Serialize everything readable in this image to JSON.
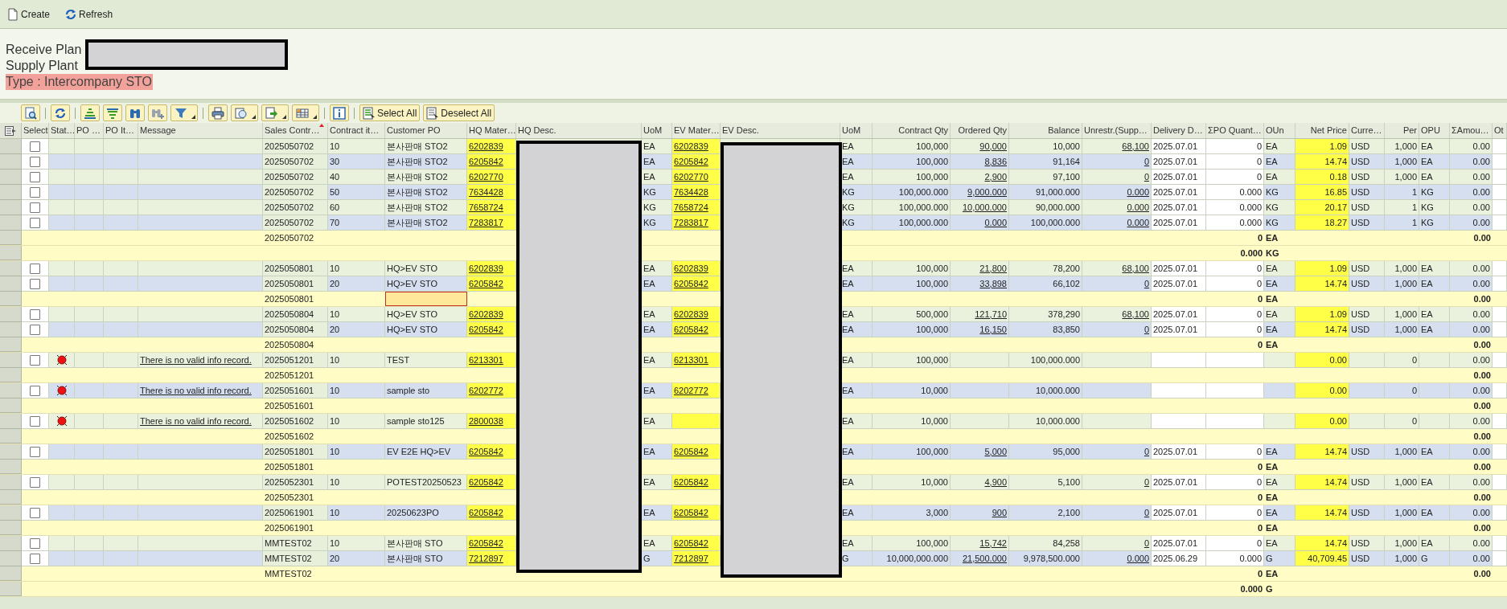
{
  "toolbar": [
    {
      "kind": "create",
      "label": "Create"
    },
    {
      "kind": "refresh",
      "label": "Refresh"
    }
  ],
  "header": {
    "receive_plant": "Receive Plan",
    "supply_plant": "Supply Plant",
    "type": "Type : Intercompany STO"
  },
  "grid_toolbar": {
    "select_all": "Select All",
    "deselect_all": "Deselect All"
  },
  "columns": [
    {
      "label": "Select",
      "sorted": false
    },
    {
      "label": "Stat…",
      "sorted": false
    },
    {
      "label": "PO …",
      "sorted": false
    },
    {
      "label": "PO It…",
      "sorted": false
    },
    {
      "label": "Message",
      "sorted": false
    },
    {
      "label": "Sales Contr…",
      "sorted": true
    },
    {
      "label": "Contract it…",
      "sorted": false
    },
    {
      "label": "Customer PO",
      "sorted": false
    },
    {
      "label": "HQ Mater…",
      "sorted": false
    },
    {
      "label": "HQ Desc.",
      "sorted": false
    },
    {
      "label": "UoM",
      "sorted": false
    },
    {
      "label": "EV Mater…",
      "sorted": false
    },
    {
      "label": "EV Desc.",
      "sorted": false
    },
    {
      "label": "UoM",
      "sorted": false
    },
    {
      "label": "Contract Qty",
      "sorted": false
    },
    {
      "label": "Ordered Qty",
      "sorted": false
    },
    {
      "label": "Balance",
      "sorted": false
    },
    {
      "label": "Unrestr.(Supp…",
      "sorted": false
    },
    {
      "label": "Delivery D…",
      "sorted": false
    },
    {
      "label": "ΣPO Quant…",
      "sorted": false
    },
    {
      "label": "OUn",
      "sorted": false
    },
    {
      "label": "Net Price",
      "sorted": false
    },
    {
      "label": "Curre…",
      "sorted": false
    },
    {
      "label": "Per",
      "sorted": false
    },
    {
      "label": "OPU",
      "sorted": false
    },
    {
      "label": "ΣAmou…",
      "sorted": false
    },
    {
      "label": "Ot",
      "sorted": false
    }
  ],
  "rows": [
    {
      "kind": "item",
      "checked": false,
      "error": false,
      "sales_contract": "2025050702",
      "contract_item": "10",
      "customer_po": "본사판매 STO2",
      "hq_material": "6202839",
      "hq_uom": "EA",
      "ev_material": "6202839",
      "ev_uom": "EA",
      "contract_qty": "100,000",
      "ordered_qty": "90,000",
      "balance": "10,000",
      "unrestricted": "68,100",
      "delivery_date": "2025.07.01",
      "po_quantity": "0",
      "oun": "EA",
      "net_price": "1.09",
      "currency": "USD",
      "per": "1,000",
      "opu": "EA",
      "amount": "0.00"
    },
    {
      "kind": "item",
      "checked": false,
      "error": false,
      "sales_contract": "2025050702",
      "contract_item": "30",
      "customer_po": "본사판매 STO2",
      "hq_material": "6205842",
      "hq_uom": "EA",
      "ev_material": "6205842",
      "ev_uom": "EA",
      "contract_qty": "100,000",
      "ordered_qty": "8,836",
      "balance": "91,164",
      "unrestricted": "0",
      "delivery_date": "2025.07.01",
      "po_quantity": "0",
      "oun": "EA",
      "net_price": "14.74",
      "currency": "USD",
      "per": "1,000",
      "opu": "EA",
      "amount": "0.00"
    },
    {
      "kind": "item",
      "checked": false,
      "error": false,
      "sales_contract": "2025050702",
      "contract_item": "40",
      "customer_po": "본사판매 STO2",
      "hq_material": "6202770",
      "hq_uom": "EA",
      "ev_material": "6202770",
      "ev_uom": "EA",
      "contract_qty": "100,000",
      "ordered_qty": "2,900",
      "balance": "97,100",
      "unrestricted": "0",
      "delivery_date": "2025.07.01",
      "po_quantity": "0",
      "oun": "EA",
      "net_price": "0.18",
      "currency": "USD",
      "per": "1,000",
      "opu": "EA",
      "amount": "0.00"
    },
    {
      "kind": "item",
      "checked": false,
      "error": false,
      "sales_contract": "2025050702",
      "contract_item": "50",
      "customer_po": "본사판매 STO2",
      "hq_material": "7634428",
      "hq_uom": "KG",
      "ev_material": "7634428",
      "ev_uom": "KG",
      "contract_qty": "100,000.000",
      "ordered_qty": "9,000.000",
      "balance": "91,000.000",
      "unrestricted": "0.000",
      "delivery_date": "2025.07.01",
      "po_quantity": "0.000",
      "oun": "KG",
      "net_price": "16.85",
      "currency": "USD",
      "per": "1",
      "opu": "KG",
      "amount": "0.00"
    },
    {
      "kind": "item",
      "checked": false,
      "error": false,
      "sales_contract": "2025050702",
      "contract_item": "60",
      "customer_po": "본사판매 STO2",
      "hq_material": "7658724",
      "hq_uom": "KG",
      "ev_material": "7658724",
      "ev_uom": "KG",
      "contract_qty": "100,000.000",
      "ordered_qty": "10,000.000",
      "balance": "90,000.000",
      "unrestricted": "0.000",
      "delivery_date": "2025.07.01",
      "po_quantity": "0.000",
      "oun": "KG",
      "net_price": "20.17",
      "currency": "USD",
      "per": "1",
      "opu": "KG",
      "amount": "0.00"
    },
    {
      "kind": "item",
      "checked": false,
      "error": false,
      "sales_contract": "2025050702",
      "contract_item": "70",
      "customer_po": "본사판매 STO2",
      "hq_material": "7283817",
      "hq_uom": "KG",
      "ev_material": "7283817",
      "ev_uom": "KG",
      "contract_qty": "100,000.000",
      "ordered_qty": "0.000",
      "balance": "100,000.000",
      "unrestricted": "0.000",
      "delivery_date": "2025.07.01",
      "po_quantity": "0.000",
      "oun": "KG",
      "net_price": "18.27",
      "currency": "USD",
      "per": "1",
      "opu": "KG",
      "amount": "0.00"
    },
    {
      "kind": "subtotal",
      "focused": false,
      "sales_contract": "2025050702",
      "po_quantity": "0",
      "oun": "EA",
      "amount": "0.00"
    },
    {
      "kind": "subtotal",
      "focused": false,
      "po_quantity": "0.000",
      "oun": "KG"
    },
    {
      "kind": "item",
      "checked": false,
      "error": false,
      "sales_contract": "2025050801",
      "contract_item": "10",
      "customer_po": "HQ>EV STO",
      "hq_material": "6202839",
      "hq_uom": "EA",
      "ev_material": "6202839",
      "ev_uom": "EA",
      "contract_qty": "100,000",
      "ordered_qty": "21,800",
      "balance": "78,200",
      "unrestricted": "68,100",
      "delivery_date": "2025.07.01",
      "po_quantity": "0",
      "oun": "EA",
      "net_price": "1.09",
      "currency": "USD",
      "per": "1,000",
      "opu": "EA",
      "amount": "0.00"
    },
    {
      "kind": "item",
      "checked": false,
      "error": false,
      "sales_contract": "2025050801",
      "contract_item": "20",
      "customer_po": "HQ>EV STO",
      "hq_material": "6205842",
      "hq_uom": "EA",
      "ev_material": "6205842",
      "ev_uom": "EA",
      "contract_qty": "100,000",
      "ordered_qty": "33,898",
      "balance": "66,102",
      "unrestricted": "0",
      "delivery_date": "2025.07.01",
      "po_quantity": "0",
      "oun": "EA",
      "net_price": "14.74",
      "currency": "USD",
      "per": "1,000",
      "opu": "EA",
      "amount": "0.00"
    },
    {
      "kind": "subtotal",
      "focused": true,
      "sales_contract": "2025050801",
      "po_quantity": "0",
      "oun": "EA",
      "amount": "0.00"
    },
    {
      "kind": "item",
      "checked": false,
      "error": false,
      "sales_contract": "2025050804",
      "contract_item": "10",
      "customer_po": "HQ>EV STO",
      "hq_material": "6202839",
      "hq_uom": "EA",
      "ev_material": "6202839",
      "ev_uom": "EA",
      "contract_qty": "500,000",
      "ordered_qty": "121,710",
      "balance": "378,290",
      "unrestricted": "68,100",
      "delivery_date": "2025.07.01",
      "po_quantity": "0",
      "oun": "EA",
      "net_price": "1.09",
      "currency": "USD",
      "per": "1,000",
      "opu": "EA",
      "amount": "0.00"
    },
    {
      "kind": "item",
      "checked": false,
      "error": false,
      "sales_contract": "2025050804",
      "contract_item": "20",
      "customer_po": "HQ>EV STO",
      "hq_material": "6205842",
      "hq_uom": "EA",
      "ev_material": "6205842",
      "ev_uom": "EA",
      "contract_qty": "100,000",
      "ordered_qty": "16,150",
      "balance": "83,850",
      "unrestricted": "0",
      "delivery_date": "2025.07.01",
      "po_quantity": "0",
      "oun": "EA",
      "net_price": "14.74",
      "currency": "USD",
      "per": "1,000",
      "opu": "EA",
      "amount": "0.00"
    },
    {
      "kind": "subtotal",
      "focused": false,
      "sales_contract": "2025050804",
      "po_quantity": "0",
      "oun": "EA",
      "amount": "0.00"
    },
    {
      "kind": "item",
      "checked": false,
      "error": true,
      "message": "There is no valid info record.",
      "sales_contract": "2025051201",
      "contract_item": "10",
      "customer_po": "TEST",
      "hq_material": "6213301",
      "hq_uom": "EA",
      "ev_material": "6213301",
      "ev_uom": "EA",
      "contract_qty": "100,000",
      "balance": "100,000.000",
      "net_price": "0.00",
      "per": "0",
      "amount": "0.00"
    },
    {
      "kind": "subtotal",
      "focused": false,
      "sales_contract": "2025051201",
      "amount": "0.00"
    },
    {
      "kind": "item",
      "checked": false,
      "error": true,
      "message": "There is no valid info record.",
      "sales_contract": "2025051601",
      "contract_item": "10",
      "customer_po": "sample sto",
      "hq_material": "6202772",
      "hq_uom": "EA",
      "ev_material": "6202772",
      "ev_uom": "EA",
      "contract_qty": "10,000",
      "balance": "10,000.000",
      "net_price": "0.00",
      "per": "0",
      "amount": "0.00"
    },
    {
      "kind": "subtotal",
      "focused": false,
      "sales_contract": "2025051601",
      "amount": "0.00"
    },
    {
      "kind": "item",
      "checked": false,
      "error": true,
      "message": "There is no valid info record.",
      "sales_contract": "2025051602",
      "contract_item": "10",
      "customer_po": "sample sto125",
      "hq_material": "2800038",
      "hq_uom": "EA",
      "ev_uom": "EA",
      "contract_qty": "10,000",
      "balance": "10,000.000",
      "net_price": "0.00",
      "per": "0",
      "amount": "0.00"
    },
    {
      "kind": "subtotal",
      "focused": false,
      "sales_contract": "2025051602",
      "amount": "0.00"
    },
    {
      "kind": "item",
      "checked": false,
      "error": false,
      "sales_contract": "2025051801",
      "contract_item": "10",
      "customer_po": "EV E2E HQ>EV",
      "hq_material": "6205842",
      "hq_uom": "EA",
      "ev_material": "6205842",
      "ev_uom": "EA",
      "contract_qty": "100,000",
      "ordered_qty": "5,000",
      "balance": "95,000",
      "unrestricted": "0",
      "delivery_date": "2025.07.01",
      "po_quantity": "0",
      "oun": "EA",
      "net_price": "14.74",
      "currency": "USD",
      "per": "1,000",
      "opu": "EA",
      "amount": "0.00"
    },
    {
      "kind": "subtotal",
      "focused": false,
      "sales_contract": "2025051801",
      "po_quantity": "0",
      "oun": "EA",
      "amount": "0.00"
    },
    {
      "kind": "item",
      "checked": false,
      "error": false,
      "sales_contract": "2025052301",
      "contract_item": "10",
      "customer_po": "POTEST20250523",
      "hq_material": "6205842",
      "hq_uom": "EA",
      "ev_material": "6205842",
      "ev_uom": "EA",
      "contract_qty": "10,000",
      "ordered_qty": "4,900",
      "balance": "5,100",
      "unrestricted": "0",
      "delivery_date": "2025.07.01",
      "po_quantity": "0",
      "oun": "EA",
      "net_price": "14.74",
      "currency": "USD",
      "per": "1,000",
      "opu": "EA",
      "amount": "0.00"
    },
    {
      "kind": "subtotal",
      "focused": false,
      "sales_contract": "2025052301",
      "po_quantity": "0",
      "oun": "EA",
      "amount": "0.00"
    },
    {
      "kind": "item",
      "checked": false,
      "error": false,
      "sales_contract": "2025061901",
      "contract_item": "10",
      "customer_po": "20250623PO",
      "hq_material": "6205842",
      "hq_uom": "EA",
      "ev_material": "6205842",
      "ev_uom": "EA",
      "contract_qty": "3,000",
      "ordered_qty": "900",
      "balance": "2,100",
      "unrestricted": "0",
      "delivery_date": "2025.07.01",
      "po_quantity": "0",
      "oun": "EA",
      "net_price": "14.74",
      "currency": "USD",
      "per": "1,000",
      "opu": "EA",
      "amount": "0.00"
    },
    {
      "kind": "subtotal",
      "focused": false,
      "sales_contract": "2025061901",
      "po_quantity": "0",
      "oun": "EA",
      "amount": "0.00"
    },
    {
      "kind": "item",
      "checked": false,
      "error": false,
      "sales_contract": "MMTEST02",
      "contract_item": "10",
      "customer_po": "본사판매 STO",
      "hq_material": "6205842",
      "hq_uom": "EA",
      "ev_material": "6205842",
      "ev_uom": "EA",
      "contract_qty": "100,000",
      "ordered_qty": "15,742",
      "balance": "84,258",
      "unrestricted": "0",
      "delivery_date": "2025.07.01",
      "po_quantity": "0",
      "oun": "EA",
      "net_price": "14.74",
      "currency": "USD",
      "per": "1,000",
      "opu": "EA",
      "amount": "0.00"
    },
    {
      "kind": "item",
      "checked": false,
      "error": false,
      "sales_contract": "MMTEST02",
      "contract_item": "20",
      "customer_po": "본사판매 STO",
      "hq_material": "7212897",
      "hq_uom": "G",
      "ev_material": "7212897",
      "ev_uom": "G",
      "contract_qty": "10,000,000.000",
      "ordered_qty": "21,500.000",
      "balance": "9,978,500.000",
      "unrestricted": "0.000",
      "delivery_date": "2025.06.29",
      "po_quantity": "0.000",
      "oun": "G",
      "net_price": "40,709.45",
      "currency": "USD",
      "per": "1,000",
      "opu": "G",
      "amount": "0.00"
    },
    {
      "kind": "subtotal",
      "focused": false,
      "sales_contract": "MMTEST02",
      "po_quantity": "0",
      "oun": "EA",
      "amount": "0.00"
    },
    {
      "kind": "subtotal",
      "focused": false,
      "po_quantity": "0.000",
      "oun": "G"
    }
  ]
}
